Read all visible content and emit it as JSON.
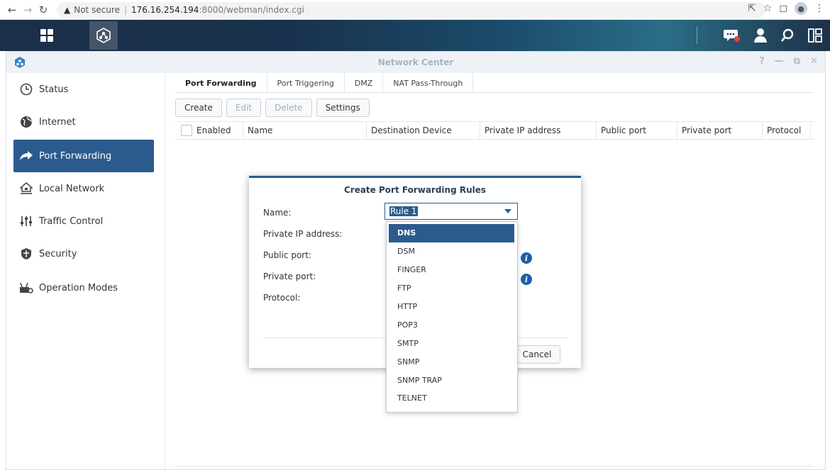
{
  "browser": {
    "security_warning": "Not secure",
    "url_host": "176.16.254.194",
    "url_rest": ":8000/webman/index.cgi"
  },
  "window": {
    "title": "Network Center"
  },
  "sidebar": {
    "items": [
      {
        "label": "Status",
        "icon": "status-icon"
      },
      {
        "label": "Internet",
        "icon": "globe-icon"
      },
      {
        "label": "Port Forwarding",
        "icon": "share-arrow-icon"
      },
      {
        "label": "Local Network",
        "icon": "home-network-icon"
      },
      {
        "label": "Traffic Control",
        "icon": "sliders-icon"
      },
      {
        "label": "Security",
        "icon": "shield-icon"
      },
      {
        "label": "Operation Modes",
        "icon": "router-gear-icon"
      }
    ],
    "active": "Port Forwarding"
  },
  "tabs": [
    "Port Forwarding",
    "Port Triggering",
    "DMZ",
    "NAT Pass-Through"
  ],
  "toolbar": {
    "create": "Create",
    "edit": "Edit",
    "delete": "Delete",
    "settings": "Settings"
  },
  "grid": {
    "columns": [
      "Enabled",
      "Name",
      "Destination Device",
      "Private IP address",
      "Public port",
      "Private port",
      "Protocol"
    ]
  },
  "modal": {
    "title": "Create Port Forwarding Rules",
    "labels": {
      "name": "Name:",
      "private_ip": "Private IP address:",
      "public_port": "Public port:",
      "private_port": "Private port:",
      "protocol": "Protocol:"
    },
    "name_value": "Rule 1",
    "cancel": "Cancel"
  },
  "dropdown": {
    "options": [
      "DNS",
      "DSM",
      "FINGER",
      "FTP",
      "HTTP",
      "POP3",
      "SMTP",
      "SNMP",
      "SNMP TRAP",
      "TELNET"
    ],
    "highlighted": "DNS"
  },
  "colors": {
    "accent": "#2b5b8e",
    "info": "#1b5fa8",
    "notification": "#e8443a"
  }
}
